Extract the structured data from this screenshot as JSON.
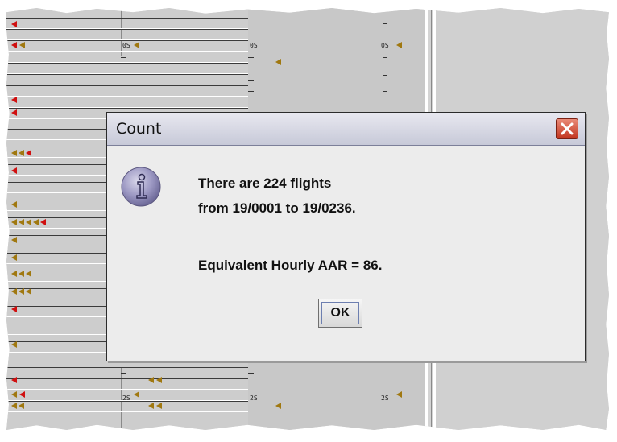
{
  "dialog": {
    "title": "Count",
    "message_line1": "There are 224 flights",
    "message_line2": "from 19/0001 to 19/0236.",
    "message_line3": "Equivalent Hourly AAR = 86.",
    "ok_label": "OK",
    "icon": "info-icon",
    "close_icon": "close-icon"
  },
  "timeline": {
    "tick_labels_top": [
      "0S",
      "0S",
      "0S"
    ],
    "tick_labels_bottom": [
      "2S",
      "2S",
      "2S"
    ],
    "arrow_colors": {
      "red": "#d01010",
      "gold": "#a07810"
    }
  }
}
